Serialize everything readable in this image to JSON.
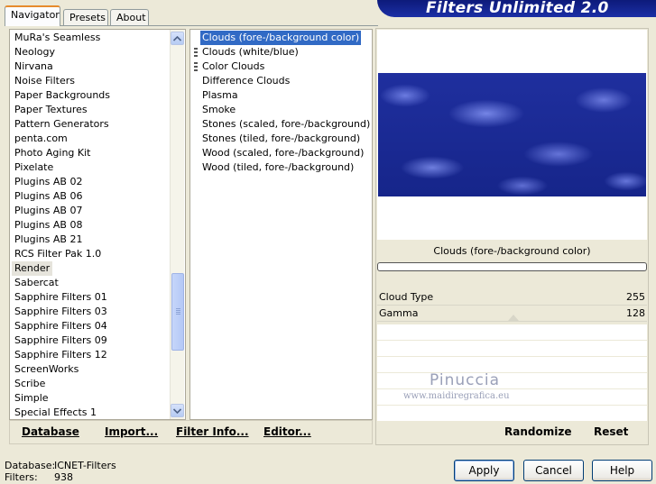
{
  "tabs": [
    "Navigator",
    "Presets",
    "About"
  ],
  "banner_title": "Filters Unlimited 2.0",
  "categories": [
    "MuRa's Seamless",
    "Neology",
    "Nirvana",
    "Noise Filters",
    "Paper Backgrounds",
    "Paper Textures",
    "Pattern Generators",
    "penta.com",
    "Photo Aging Kit",
    "Pixelate",
    "Plugins AB 02",
    "Plugins AB 06",
    "Plugins AB 07",
    "Plugins AB 08",
    "Plugins AB 21",
    "RCS Filter Pak 1.0",
    "Render",
    "Sabercat",
    "Sapphire Filters 01",
    "Sapphire Filters 03",
    "Sapphire Filters 04",
    "Sapphire Filters 09",
    "Sapphire Filters 12",
    "ScreenWorks",
    "Scribe",
    "Simple",
    "Special Effects 1"
  ],
  "selected_category": "Render",
  "filters": [
    "Clouds (fore-/background color)",
    "Clouds (white/blue)",
    "Color Clouds",
    "Difference Clouds",
    "Plasma",
    "Smoke",
    "Stones (scaled, fore-/background)",
    "Stones (tiled, fore-/background)",
    "Wood (scaled, fore-/background)",
    "Wood (tiled, fore-/background)"
  ],
  "selected_filter": "Clouds (fore-/background color)",
  "toolbar": {
    "database": "Database",
    "import": "Import...",
    "filter_info": "Filter Info...",
    "editor": "Editor...",
    "randomize": "Randomize",
    "reset": "Reset"
  },
  "preview": {
    "filter_name": "Clouds (fore-/background color)",
    "progress": 0
  },
  "params": [
    {
      "label": "Cloud Type",
      "value": "255"
    },
    {
      "label": "Gamma",
      "value": "128"
    }
  ],
  "watermark": {
    "name": "Pinuccia",
    "url": "www.maidiregrafica.eu"
  },
  "status": {
    "database_label": "Database:",
    "database_value": "ICNET-Filters",
    "filters_label": "Filters:",
    "filters_value": "938"
  },
  "buttons": {
    "apply": "Apply",
    "cancel": "Cancel",
    "help": "Help"
  },
  "colors": {
    "selection": "#316ac5",
    "banner": "#1b2fa6",
    "cloud_base": "#1f2f9e"
  }
}
